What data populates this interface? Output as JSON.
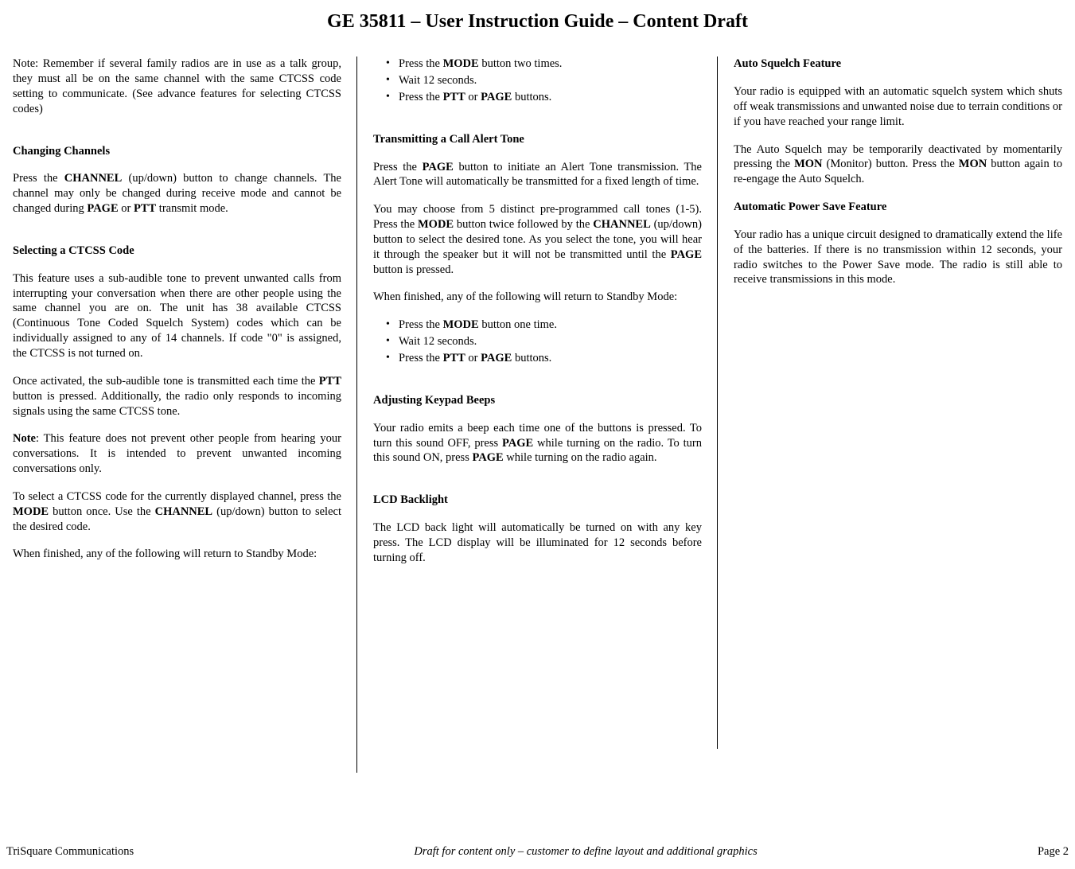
{
  "title": "GE 35811 – User Instruction Guide – Content Draft",
  "col1": {
    "note_intro": "Note:  Remember if several family radios are in use as a talk group, they must all be on the same channel with the same CTCSS code setting to communicate.  (See advance features for selecting  CTCSS codes)",
    "h_changing": "Changing Channels",
    "changing_p1a": "Press the ",
    "changing_b1": "CHANNEL",
    "changing_p1b": " (up/down) button to change channels.  The channel may only be changed during receive mode and cannot be changed during ",
    "changing_b2": "PAGE",
    "changing_p1c": " or ",
    "changing_b3": "PTT",
    "changing_p1d": " transmit mode.",
    "h_ctcss": "Selecting a CTCSS Code",
    "ctcss_p1": "This feature uses a sub-audible tone to prevent unwanted calls from interrupting your conversation when there are  other people using the same channel you are on.  The unit has 38 available CTCSS (Continuous Tone Coded Squelch System) codes which can be individually assigned to any of 14 channels.  If code \"0\" is assigned, the CTCSS is not turned on.",
    "ctcss_p2a": "Once activated, the sub-audible tone is transmitted each time the ",
    "ctcss_b1": "PTT",
    "ctcss_p2b": " button is pressed.  Additionally, the radio only responds to incoming signals using the same CTCSS tone.",
    "ctcss_note_b": "Note",
    "ctcss_note": ":  This feature does not prevent other people from hearing your conversations.  It is intended to prevent unwanted incoming conversations only.",
    "ctcss_p3a": "To select a CTCSS code for the currently displayed channel, press the ",
    "ctcss_b2": "MODE",
    "ctcss_p3b": " button once.  Use the ",
    "ctcss_b3": "CHANNEL",
    "ctcss_p3c": " (up/down) button to select the desired code.",
    "ctcss_p4": "When finished, any of the following will return to Standby Mode:"
  },
  "col2": {
    "li1a": "Press the ",
    "li1b": "MODE",
    "li1c": " button two times.",
    "li2": "Wait 12 seconds.",
    "li3a": "Press the ",
    "li3b": "PTT",
    "li3c": " or ",
    "li3d": "PAGE",
    "li3e": " buttons.",
    "h_alert": "Transmitting a Call Alert Tone",
    "alert_p1a": "Press the ",
    "alert_b1": "PAGE",
    "alert_p1b": " button to initiate an Alert Tone transmission.  The Alert Tone will automatically be transmitted for a fixed length of time.",
    "alert_p2a": "You may choose from 5 distinct pre-programmed call tones (1-5).  Press the ",
    "alert_b2": "MODE",
    "alert_p2b": " button twice followed by the ",
    "alert_b3": "CHANNEL",
    "alert_p2c": " (up/down) button to select the desired tone.  As you select the tone, you will hear it through the speaker but it will not be transmitted until the ",
    "alert_b4": "PAGE",
    "alert_p2d": " button is pressed.",
    "alert_p3": "When finished, any of the following will return to Standby Mode:",
    "li4a": "Press the ",
    "li4b": "MODE",
    "li4c": " button one time.",
    "li5": "Wait 12 seconds.",
    "li6a": "Press the ",
    "li6b": "PTT",
    "li6c": " or ",
    "li6d": "PAGE",
    "li6e": " buttons.",
    "h_beeps": "Adjusting Keypad Beeps",
    "beeps_p1a": "Your radio emits a beep each time one of the buttons is pressed.  To turn this sound OFF, press ",
    "beeps_b1": "PAGE",
    "beeps_p1b": " while turning on the radio.  To turn this sound ON, press ",
    "beeps_b2": "PAGE",
    "beeps_p1c": " while turning on the radio again.",
    "h_lcd": "LCD Backlight",
    "lcd_p1": "The LCD back light will automatically be turned on with any key press.  The LCD display will be illuminated for 12 seconds before turning off."
  },
  "col3": {
    "h_squelch": "Auto Squelch Feature",
    "squelch_p1": "Your radio is equipped with an automatic squelch system which shuts off weak transmissions and unwanted noise due to terrain conditions or if you have reached your range limit.",
    "squelch_p2a": "The Auto Squelch may be temporarily deactivated by momentarily pressing the ",
    "squelch_b1": "MON",
    "squelch_p2b": " (Monitor) button.  Press the ",
    "squelch_b2": "MON",
    "squelch_p2c": " button again to re-engage the Auto Squelch.",
    "h_power": "Automatic Power Save Feature",
    "power_p1": "Your radio has a unique circuit designed to dramatically extend the life of the batteries.  If there is no transmission within 12 seconds, your radio switches to the Power Save mode.  The radio is still able to receive transmissions in this mode."
  },
  "footer": {
    "left": "TriSquare Communications",
    "center": "Draft for content only – customer to define layout and additional graphics",
    "right": "Page 2"
  }
}
